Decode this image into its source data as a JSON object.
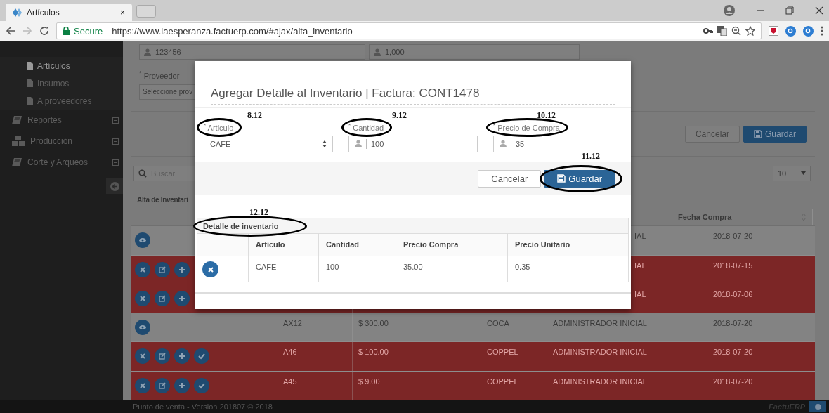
{
  "browser": {
    "tab": {
      "title": "Artículos",
      "close": "×"
    },
    "address": {
      "security": "Secure",
      "url": "https://www.laesperanza.factuerp.com/#ajax/alta_inventario"
    }
  },
  "sidebar": {
    "items": [
      {
        "label": "Artículos",
        "kind": "sub",
        "selected": true
      },
      {
        "label": "Insumos",
        "kind": "sub",
        "selected": false
      },
      {
        "label": "A proveedores",
        "kind": "sub",
        "selected": false
      },
      {
        "label": "Reportes",
        "kind": "book",
        "selected": false
      },
      {
        "label": "Producción",
        "kind": "boxes",
        "selected": false
      },
      {
        "label": "Corte y Arqueos",
        "kind": "book",
        "selected": false
      }
    ]
  },
  "form": {
    "code": "123456",
    "quantity": "1,000",
    "provider_label": "$^{*}$ Proveedor",
    "provider_value": "Seleccione prov",
    "buttons": [
      {
        "label": "Cancelar",
        "kind": "secondary"
      },
      {
        "label": "Guardar",
        "kind": "primary"
      }
    ]
  },
  "list": {
    "search_placeholder": "Buscar",
    "page_size": "10",
    "title": "Alta de Inventari",
    "column": "Fecha Compra",
    "rows": [
      {
        "kind": "done",
        "approve": false,
        "user": "IAL",
        "date": "2018-07-20"
      },
      {
        "kind": "pending",
        "approve": false,
        "user": "IAL",
        "date": "2018-07-15"
      },
      {
        "kind": "pending",
        "approve": false,
        "user": "IAL",
        "date": "2018-07-06"
      },
      {
        "kind": "done",
        "approve": false,
        "code": "AX12",
        "amount": "$ 300.00",
        "provider": "COCA",
        "user": "ADMINISTRADOR INICIAL",
        "date": "2018-07-20"
      },
      {
        "kind": "pending",
        "approve": true,
        "code": "A46",
        "amount": "$ 100.00",
        "provider": "COPPEL",
        "user": "ADMINISTRADOR INICIAL",
        "date": "2018-07-20"
      },
      {
        "kind": "pending",
        "approve": true,
        "code": "A45",
        "amount": "$ 9.00",
        "provider": "COPPEL",
        "user": "ADMINISTRADOR INICIAL",
        "date": "2018-07-20"
      }
    ]
  },
  "modal": {
    "title": "Agregar Detalle al Inventario | Factura: CONT1478",
    "fields": [
      {
        "note": "8.12",
        "label": "$^{*}$ Articulo",
        "value": "CAFE",
        "kind": "select"
      },
      {
        "note": "9.12",
        "label": "$^{*}$ Cantidad",
        "value": "100",
        "kind": "input"
      },
      {
        "note": "10.12",
        "label": "$^{*}$ Precio de Compra",
        "value": "35",
        "kind": "input"
      }
    ],
    "buttons": [
      {
        "label": "Cancelar",
        "kind": "secondary"
      },
      {
        "label": "Guardar",
        "kind": "primary",
        "note": "11.12"
      }
    ],
    "detail": {
      "note": "12.12",
      "title": "Detalle de inventario",
      "columns": [
        "Articulo",
        "Cantidad",
        "Precio Compra",
        "Precio Unitario"
      ],
      "rows": [
        [
          "CAFE",
          "100",
          "35.00",
          "0.35"
        ]
      ]
    }
  },
  "footer": {
    "text": "Punto de venta - Version 201807 © 2018",
    "brand": "FactuERP"
  }
}
